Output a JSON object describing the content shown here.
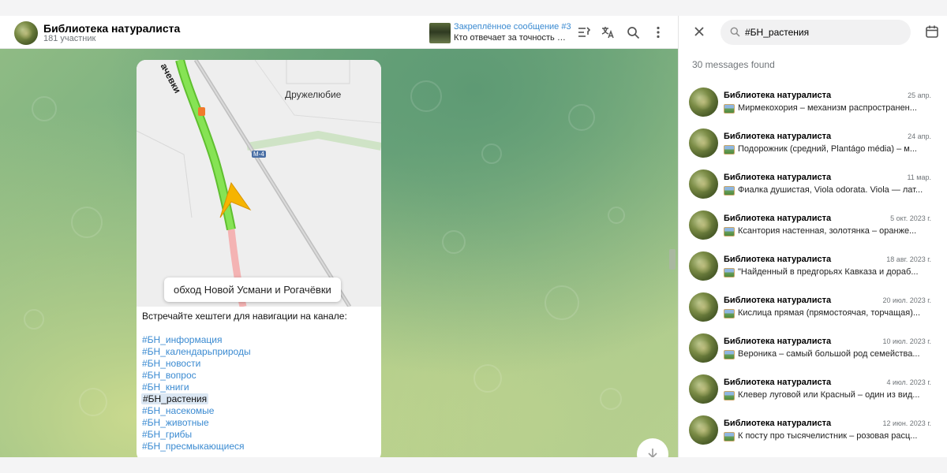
{
  "chat": {
    "title": "Библиотека натуралиста",
    "subtitle": "181 участник",
    "pinned_title": "Закреплённое сообщение #3",
    "pinned_text": "Кто отвечает за точность оп..."
  },
  "icons": [
    "pinned-list-icon",
    "translate-icon",
    "search-icon",
    "more-icon",
    "close-icon",
    "calendar-icon",
    "chevron-down-icon"
  ],
  "message": {
    "map_caption": "обход Новой Усмани и Рогачёвки",
    "map_town": "Дружелюбие",
    "map_road_label": "ачевки",
    "map_highway": "M-4",
    "intro": "Встречайте хештеги для навигации на канале:",
    "hashtags": [
      "#БН_информация",
      "#БН_календарьприроды",
      "#БН_новости",
      "#БН_вопрос",
      "#БН_книги",
      "#БН_растения",
      "#БН_насекомые",
      "#БН_животные",
      "#БН_грибы",
      "#БН_пресмыкающиеся"
    ],
    "active_hashtag_index": 5
  },
  "search": {
    "query": "#БН_растения",
    "results_count": "30 messages found"
  },
  "results": [
    {
      "title": "Библиотека натуралиста",
      "date": "25 апр.",
      "snippet": "Мирмекохория – механизм распространен..."
    },
    {
      "title": "Библиотека натуралиста",
      "date": "24 апр.",
      "snippet": "Подорожник (средний, Plantágo média) – м..."
    },
    {
      "title": "Библиотека натуралиста",
      "date": "11 мар.",
      "snippet": "Фиалка душистая, Viola odorata. Viola — лат..."
    },
    {
      "title": "Библиотека натуралиста",
      "date": "5 окт. 2023 г.",
      "snippet": "Ксантория настенная, золотянка – оранже..."
    },
    {
      "title": "Библиотека натуралиста",
      "date": "18 авг. 2023 г.",
      "snippet": "\"Найденный в предгорьях Кавказа и дораб..."
    },
    {
      "title": "Библиотека натуралиста",
      "date": "20 июл. 2023 г.",
      "snippet": "Кислица прямая (прямостоячая, торчащая)..."
    },
    {
      "title": "Библиотека натуралиста",
      "date": "10 июл. 2023 г.",
      "snippet": "Вероника – самый большой род семейства..."
    },
    {
      "title": "Библиотека натуралиста",
      "date": "4 июл. 2023 г.",
      "snippet": "Клевер луговой или Красный – один из вид..."
    },
    {
      "title": "Библиотека натуралиста",
      "date": "12 июн. 2023 г.",
      "snippet": "К посту про тысячелистник – розовая расц..."
    }
  ],
  "colors": {
    "accent": "#3a8ad1",
    "route_green": "#7ee04a",
    "route_red": "#f2a9a9",
    "arrow_yellow": "#f5b800"
  }
}
